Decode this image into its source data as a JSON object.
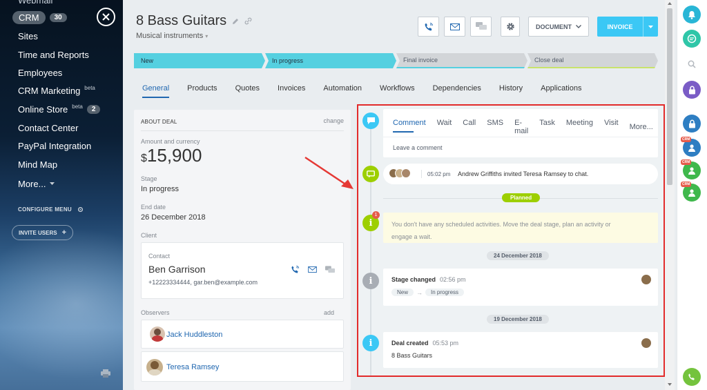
{
  "sidebar": {
    "cut_item": "Webmail",
    "crm_label": "CRM",
    "crm_count": "30",
    "items": [
      {
        "label": "Sites"
      },
      {
        "label": "Time and Reports"
      },
      {
        "label": "Employees"
      },
      {
        "label": "CRM Marketing",
        "sup": "beta"
      },
      {
        "label": "Online Store",
        "sup": "beta",
        "count": "2"
      },
      {
        "label": "Contact Center"
      },
      {
        "label": "PayPal Integration"
      },
      {
        "label": "Mind Map"
      },
      {
        "label": "More..."
      }
    ],
    "configure_menu": "CONFIGURE MENU",
    "invite_users": "INVITE USERS"
  },
  "header": {
    "title": "8 Bass Guitars",
    "subtitle": "Musical instruments",
    "document_label": "DOCUMENT",
    "invoice_label": "INVOICE"
  },
  "stages": [
    {
      "label": "New",
      "color": "#55d0e0"
    },
    {
      "label": "In progress",
      "color": "#55d0e0"
    },
    {
      "label": "Final invoice",
      "color": "#d2d5d8"
    },
    {
      "label": "Close deal",
      "color": "#d2d5d8"
    }
  ],
  "tabs": [
    "General",
    "Products",
    "Quotes",
    "Invoices",
    "Automation",
    "Workflows",
    "Dependencies",
    "History",
    "Applications"
  ],
  "about": {
    "heading": "ABOUT DEAL",
    "change_label": "change",
    "amount_label": "Amount and currency",
    "amount_currency": "$",
    "amount_value": "15,900",
    "stage_label": "Stage",
    "stage_value": "In progress",
    "end_label": "End date",
    "end_value": "26 December 2018",
    "client_label": "Client",
    "contact_label": "Contact",
    "contact_name": "Ben Garrison",
    "contact_details": "+12223334444, gar.ben@example.com",
    "observers_label": "Observers",
    "add_label": "add",
    "observers": [
      "Jack Huddleston",
      "Teresa Ramsey"
    ]
  },
  "timeline": {
    "comment_tabs": [
      "Comment",
      "Wait",
      "Call",
      "SMS",
      "E-mail",
      "Task",
      "Meeting",
      "Visit",
      "More..."
    ],
    "comment_placeholder": "Leave a comment",
    "chat_time": "05:02 pm",
    "chat_text": "Andrew Griffiths invited Teresa Ramsey to chat.",
    "planned_label": "Planned",
    "planned_badge": "1",
    "planned_text": "You don't have any scheduled activities. Move the deal stage, plan an activity or engage a wait.",
    "date1": "24 December 2018",
    "stage_changed_title": "Stage changed",
    "stage_changed_time": "02:56 pm",
    "stage_from": "New",
    "stage_to": "In progress",
    "date2": "19 December 2018",
    "deal_created_title": "Deal created",
    "deal_created_time": "05:53 pm",
    "deal_created_text": "8 Bass Guitars"
  },
  "rightbar": {
    "crm_badge": "CRM"
  },
  "colors": {
    "accent": "#3bc8f5",
    "active_tab": "#2067b0",
    "highlight_border": "#e22a2a",
    "planned": "#9dcf00"
  }
}
